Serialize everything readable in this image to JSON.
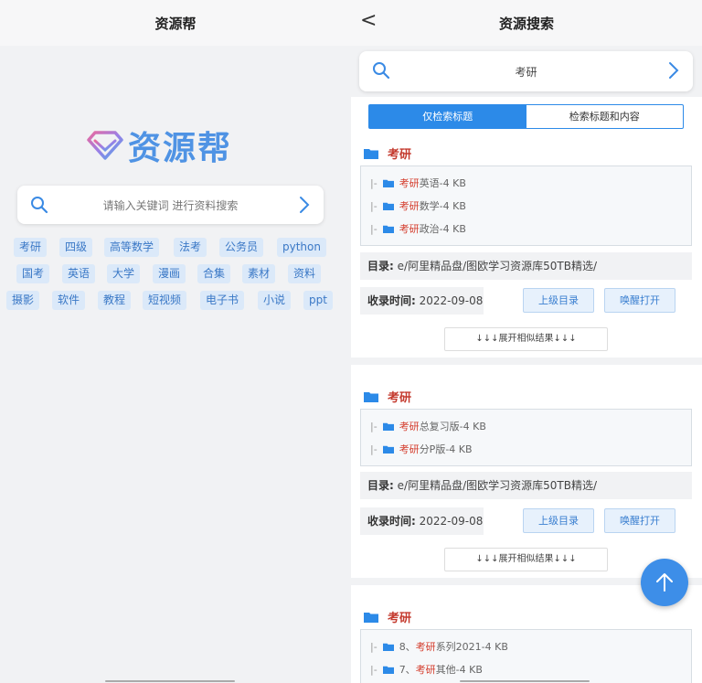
{
  "left": {
    "nav_title": "资源帮",
    "logo_text": "资源帮",
    "search_placeholder": "请输入关键词 进行资料搜索",
    "tag_rows": [
      [
        "考研",
        "四级",
        "高等数学",
        "法考",
        "公务员",
        "python"
      ],
      [
        "国考",
        "英语",
        "大学",
        "漫画",
        "合集",
        "素材",
        "资料"
      ],
      [
        "摄影",
        "软件",
        "教程",
        "短视频",
        "电子书",
        "小说",
        "ppt"
      ]
    ]
  },
  "right": {
    "nav_title": "资源搜索",
    "back_icon": "<",
    "search_value": "考研",
    "toggle": {
      "options": [
        "仅检索标题",
        "检索标题和内容"
      ],
      "selected": "仅检索标题"
    },
    "results": [
      {
        "title": "考研",
        "files": [
          {
            "prefix": "|-",
            "num": "",
            "kw": "考研",
            "rest": "英语-4 KB"
          },
          {
            "prefix": "|-",
            "num": "",
            "kw": "考研",
            "rest": "数学-4 KB"
          },
          {
            "prefix": "|-",
            "num": "",
            "kw": "考研",
            "rest": "政治-4 KB"
          }
        ],
        "dir_label": "目录:",
        "dir_path": "e/阿里精品盘/图欧学习资源库50TB精选/",
        "date_label": "收录时间:",
        "date": "2022-09-08",
        "btn_parent": "上级目录",
        "btn_open": "唤醒打开",
        "expand": "↓↓↓展开相似结果↓↓↓"
      },
      {
        "title": "考研",
        "files": [
          {
            "prefix": "|-",
            "num": "",
            "kw": "考研",
            "rest": "总复习版-4 KB"
          },
          {
            "prefix": "|-",
            "num": "",
            "kw": "考研",
            "rest": "分P版-4 KB"
          }
        ],
        "dir_label": "目录:",
        "dir_path": "e/阿里精品盘/图欧学习资源库50TB精选/",
        "date_label": "收录时间:",
        "date": "2022-09-08",
        "btn_parent": "上级目录",
        "btn_open": "唤醒打开",
        "expand": "↓↓↓展开相似结果↓↓↓"
      },
      {
        "title": "考研",
        "files": [
          {
            "prefix": "|-",
            "num": "8、",
            "kw": "考研",
            "rest": "系列2021-4 KB"
          },
          {
            "prefix": "|-",
            "num": "7、",
            "kw": "考研",
            "rest": "其他-4 KB"
          }
        ]
      }
    ]
  },
  "icons": {
    "search": "search-icon",
    "chevron": "chevron-right-icon",
    "folder": "folder-icon",
    "diamond": "diamond-logo-icon",
    "up": "arrow-up-icon"
  },
  "colors": {
    "accent": "#2c8ae8",
    "keyword": "#d43c2c",
    "tag_bg": "#dbe9f9",
    "logo": "#4f93e4"
  }
}
